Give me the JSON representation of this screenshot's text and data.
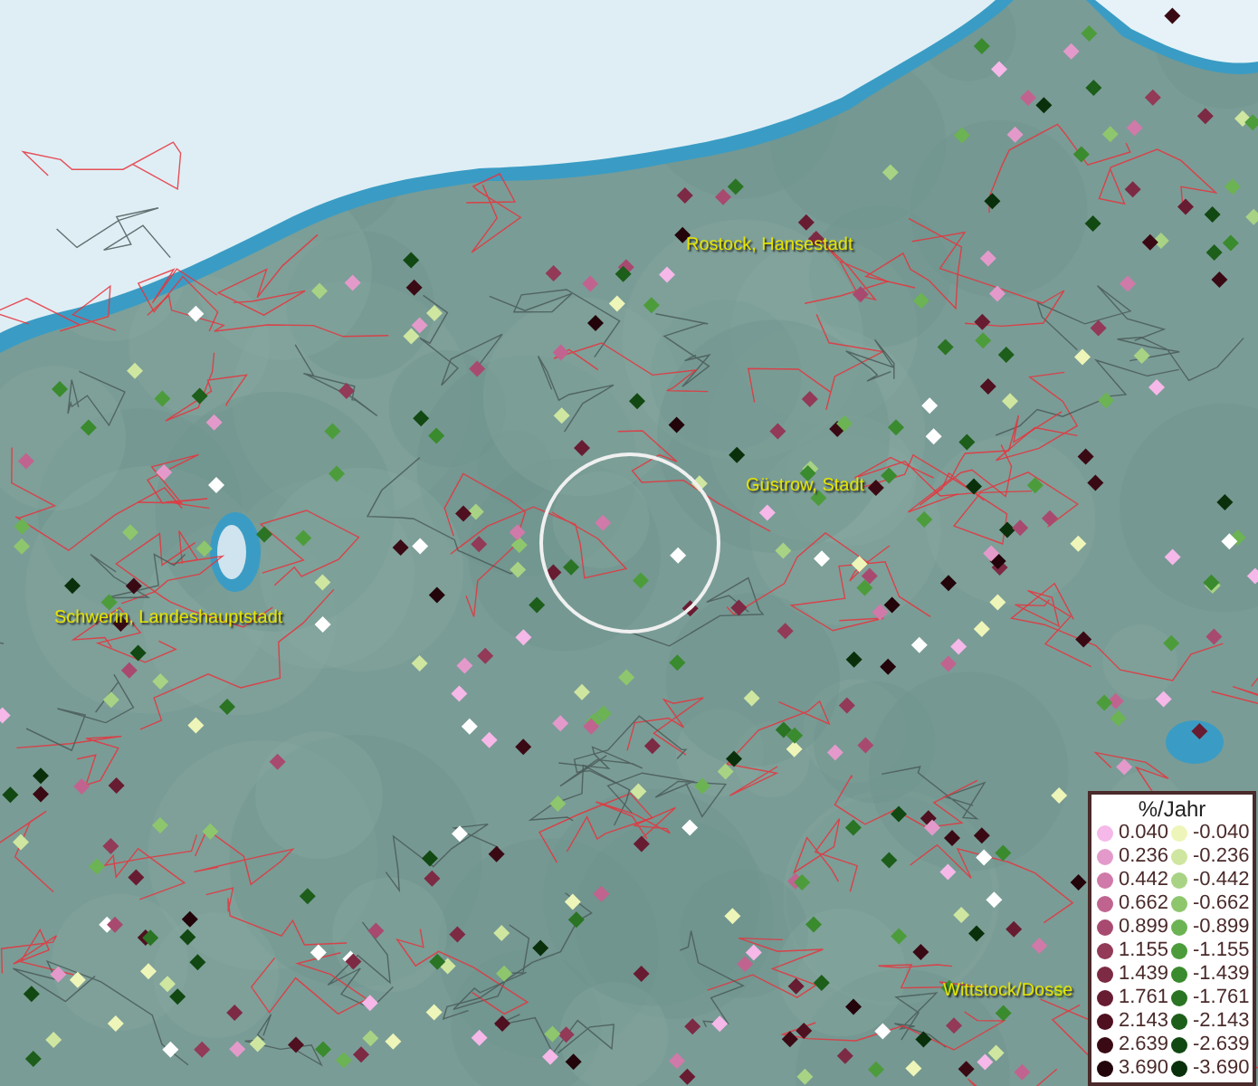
{
  "map": {
    "places": [
      {
        "name": "Rostock, Hansestadt"
      },
      {
        "name": "Güstrow, Stadt"
      },
      {
        "name": "Schwerin, Landeshauptstadt"
      },
      {
        "name": "Wittstock/Dosse"
      }
    ]
  },
  "legend": {
    "title": "%/Jahr",
    "rows": [
      {
        "positive": {
          "label": "0.040",
          "color": "#f5b8e8"
        },
        "negative": {
          "label": "-0.040",
          "color": "#eef5b8"
        }
      },
      {
        "positive": {
          "label": "0.236",
          "color": "#e39acb"
        },
        "negative": {
          "label": "-0.236",
          "color": "#cfe6a0"
        }
      },
      {
        "positive": {
          "label": "0.442",
          "color": "#d07aa9"
        },
        "negative": {
          "label": "-0.442",
          "color": "#a8d384"
        }
      },
      {
        "positive": {
          "label": "0.662",
          "color": "#c0648f"
        },
        "negative": {
          "label": "-0.662",
          "color": "#8ec66d"
        }
      },
      {
        "positive": {
          "label": "0.899",
          "color": "#a84a70"
        },
        "negative": {
          "label": "-0.899",
          "color": "#6cb354"
        }
      },
      {
        "positive": {
          "label": "1.155",
          "color": "#923a57"
        },
        "negative": {
          "label": "-1.155",
          "color": "#4d9c3b"
        }
      },
      {
        "positive": {
          "label": "1.439",
          "color": "#7d2a44"
        },
        "negative": {
          "label": "-1.439",
          "color": "#3a8a2e"
        }
      },
      {
        "positive": {
          "label": "1.761",
          "color": "#681c31"
        },
        "negative": {
          "label": "-1.761",
          "color": "#2a7424"
        }
      },
      {
        "positive": {
          "label": "2.143",
          "color": "#4f1020"
        },
        "negative": {
          "label": "-2.143",
          "color": "#1c5e1a"
        }
      },
      {
        "positive": {
          "label": "2.639",
          "color": "#3a0a14"
        },
        "negative": {
          "label": "-2.639",
          "color": "#124812"
        }
      },
      {
        "positive": {
          "label": "3.690",
          "color": "#22040a"
        },
        "negative": {
          "label": "-3.690",
          "color": "#0a300b"
        }
      }
    ]
  }
}
